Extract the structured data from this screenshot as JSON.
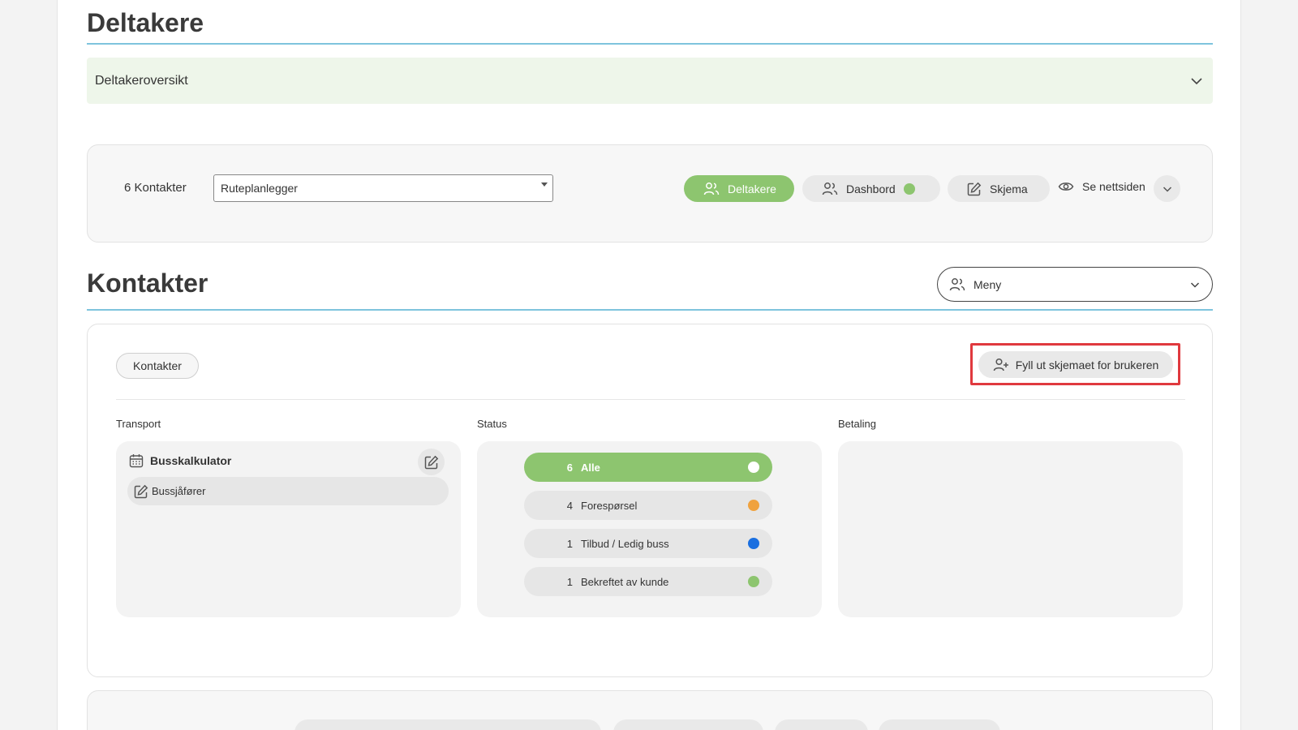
{
  "header": {
    "title": "Deltakere"
  },
  "accordion": {
    "label": "Deltakeroversikt"
  },
  "toolbar": {
    "contacts_count": "6 Kontakter",
    "select_value": "Ruteplanlegger",
    "tabs": [
      {
        "label": "Deltakere",
        "active": true
      },
      {
        "label": "Dashbord",
        "status_color": "#8dc56f"
      },
      {
        "label": "Skjema"
      }
    ],
    "view_site_label": "Se nettsiden"
  },
  "contacts_section": {
    "title": "Kontakter",
    "menu_label": "Meny"
  },
  "contacts_panel": {
    "tag_button": "Kontakter",
    "fill_form_button": "Fyll ut skjemaet for brukeren",
    "columns": {
      "transport": "Transport",
      "status": "Status",
      "payment": "Betaling"
    },
    "transport": {
      "calculator_label": "Busskalkulator",
      "driver_label": "Bussjåfører"
    },
    "statuses": [
      {
        "count": "6",
        "label": "Alle",
        "color": "#ffffff",
        "selected": true
      },
      {
        "count": "4",
        "label": "Forespørsel",
        "color": "#f0a23e",
        "selected": false
      },
      {
        "count": "1",
        "label": "Tilbud / Ledig buss",
        "color": "#1a6fe0",
        "selected": false
      },
      {
        "count": "1",
        "label": "Bekreftet av kunde",
        "color": "#8dc56f",
        "selected": false
      }
    ]
  },
  "colors": {
    "accent_green": "#8dc56f",
    "rule_blue": "#7ec4dd",
    "highlight_red": "#e0393e"
  }
}
